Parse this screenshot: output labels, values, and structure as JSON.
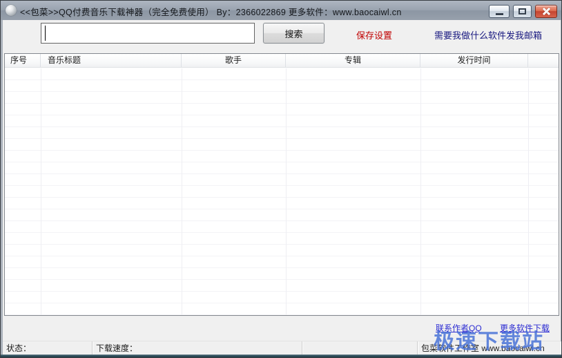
{
  "window": {
    "title": "<<包菜>>QQ付费音乐下载神器（完全免费使用）  By：2366022869    更多软件：www.baocaiwl.cn"
  },
  "icons": {
    "app_icon": "sphere-app-icon",
    "minimize_icon": "dash",
    "maximize_icon": "square-outline",
    "close_icon": "x-cross"
  },
  "search": {
    "value": "",
    "placeholder": "",
    "button_label": "搜索"
  },
  "toolbar": {
    "save_settings": "保存设置",
    "email_link": "需要我做什么软件发我邮箱"
  },
  "listview": {
    "headers": [
      "序号",
      "音乐标题",
      "歌手",
      "专辑",
      "发行时间"
    ],
    "rows": []
  },
  "footer_links": {
    "contact": "联系作者QQ",
    "more": "更多软件下载"
  },
  "watermark": {
    "text": "极速下载站"
  },
  "status": {
    "state_label": "状态：",
    "speed_label": "下载速度：",
    "studio_label": "包菜软件工作室 www.baocaiwl.cn"
  },
  "colors": {
    "save_settings_red": "#c00000",
    "email_link_navy": "#17177f",
    "hyperlink_blue": "#2a2ad2",
    "watermark_blue": "#4a74d8",
    "titlebar_gray_blue": "#99a3af",
    "close_button_red": "#c44430"
  }
}
